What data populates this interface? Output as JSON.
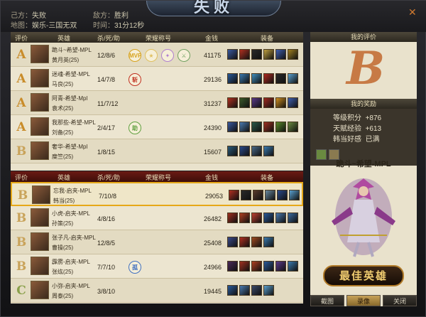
{
  "top": {
    "own_team_label": "己方：",
    "own_result": "失败",
    "enemy_label": "敌方：",
    "enemy_result": "胜利",
    "map_label": "地图：",
    "map": "娱乐-三国无双",
    "time_label": "时间：",
    "time": "31分12秒",
    "banner": "失败"
  },
  "columns": {
    "rating": "评价",
    "hero": "英雄",
    "kda": "杀/死/助",
    "honor": "荣耀称号",
    "gold": "金钱",
    "equip": "装备"
  },
  "team1": [
    {
      "rank": "A",
      "player": "跪斗~希望-MPL",
      "hero": "黄月英(25)",
      "kda": "12/8/6",
      "gold": "41175",
      "honors": [
        {
          "text": "MVP",
          "color": "#d7a31f",
          "icon": "mvp-badge-icon"
        },
        {
          "text": "★",
          "color": "#e0c060",
          "icon": "star-badge-icon"
        },
        {
          "text": "✦",
          "color": "#b080d0",
          "icon": "gem-badge-icon"
        },
        {
          "text": "⚔",
          "color": "#70a060",
          "icon": "swords-badge-icon"
        }
      ],
      "items": [
        "#3a5aa0",
        "#b03020",
        "#2a2a2a",
        "#c0a040",
        "#4060b0",
        "#a08020"
      ]
    },
    {
      "rank": "A",
      "player": "迷魂-希望-MPL",
      "hero": "马良(25)",
      "kda": "14/7/8",
      "gold": "29136",
      "honors": [
        {
          "text": "斩",
          "color": "#c03020",
          "icon": "slay-badge-icon"
        }
      ],
      "items": [
        "#2a5a9a",
        "#3a7ab0",
        "#4090c0",
        "#b02a20",
        "#2a2a2a",
        "#5aa0d0"
      ]
    },
    {
      "rank": "A",
      "player": "阿青-希望-Mpl",
      "hero": "袁术(25)",
      "kda": "11/7/12",
      "gold": "31237",
      "honors": [],
      "items": [
        "#b03020",
        "#3a5a2a",
        "#5a3a8a",
        "#a02a20",
        "#d09020",
        "#4060b0"
      ]
    },
    {
      "rank": "A",
      "player": "我那些-希望-MPL",
      "hero": "刘备(25)",
      "kda": "2/4/17",
      "gold": "24390",
      "honors": [
        {
          "text": "助",
          "color": "#60a040",
          "icon": "assist-badge-icon"
        }
      ],
      "items": [
        "#3a5aa0",
        "#4a7ab0",
        "#2a5a4a",
        "#a03020",
        "#5a8a2a",
        "#6a8a40"
      ]
    },
    {
      "rank": "B",
      "player": "奢华-希望-Mpl",
      "hero": "糜竺(25)",
      "kda": "1/8/15",
      "gold": "15607",
      "honors": [],
      "items": [
        "#2a5a7a",
        "#2a4a8a",
        "#4a6a8a",
        "#3a7ab0"
      ]
    }
  ],
  "team2": [
    {
      "rank": "B",
      "player": "忘我-启夹-MPL",
      "hero": "韩当(25)",
      "kda": "7/10/8",
      "gold": "29053",
      "honors": [],
      "items": [
        "#b03020",
        "#2a2a2a",
        "#5a3a2a",
        "#6a8aa0",
        "#2a4a8a",
        "#5aa0d0"
      ],
      "highlight": true
    },
    {
      "rank": "B",
      "player": "小虎-启夹-MPL",
      "hero": "孙策(25)",
      "kda": "4/8/16",
      "gold": "26482",
      "honors": [],
      "items": [
        "#a03020",
        "#b04020",
        "#c04030",
        "#2a5a9a",
        "#4a7ab0",
        "#3a6aa0"
      ]
    },
    {
      "rank": "B",
      "player": "张子凡-启夹-MPL",
      "hero": "曹操(25)",
      "kda": "12/8/5",
      "gold": "25408",
      "honors": [],
      "items": [
        "#3a4a8a",
        "#b03020",
        "#a04a20",
        "#3a7ab0"
      ]
    },
    {
      "rank": "B",
      "player": "霹雳-启夹-MPL",
      "hero": "张纮(25)",
      "kda": "7/7/10",
      "gold": "24966",
      "honors": [
        {
          "text": "孤",
          "color": "#4070c0",
          "icon": "lone-badge-icon"
        }
      ],
      "items": [
        "#4a2a5a",
        "#a03020",
        "#b04020",
        "#2a5a9a",
        "#5a3a8a",
        "#3a7ab0"
      ]
    },
    {
      "rank": "C",
      "player": "小弥-启夹-MPL",
      "hero": "周泰(25)",
      "kda": "3/8/10",
      "gold": "19445",
      "honors": [],
      "items": [
        "#2a5a9a",
        "#4a7ab0",
        "#3a4a6a",
        "#5aa0d0"
      ]
    }
  ],
  "right": {
    "eval_title": "我的评价",
    "grade": "B",
    "reward_title": "我的奖励",
    "rewards": [
      {
        "label": "等级积分",
        "value": "+876"
      },
      {
        "label": "天赋经验",
        "value": "+613"
      },
      {
        "label": "韩当好感",
        "value": "已满"
      }
    ],
    "mvp_name": "跪斗~希望-MPL",
    "best_label": "最佳英雄"
  },
  "buttons": {
    "screenshot": "截图",
    "replay": "录像",
    "close": "关闭"
  }
}
